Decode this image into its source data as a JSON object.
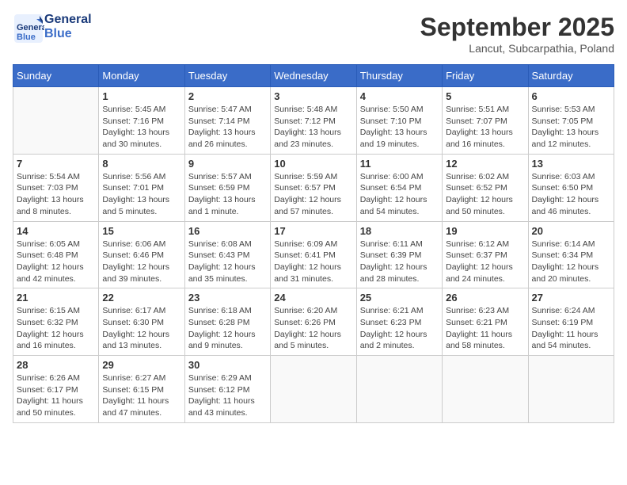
{
  "header": {
    "logo_text_general": "General",
    "logo_text_blue": "Blue",
    "month_title": "September 2025",
    "location": "Lancut, Subcarpathia, Poland"
  },
  "weekdays": [
    "Sunday",
    "Monday",
    "Tuesday",
    "Wednesday",
    "Thursday",
    "Friday",
    "Saturday"
  ],
  "weeks": [
    [
      {
        "day": "",
        "sunrise": "",
        "sunset": "",
        "daylight": ""
      },
      {
        "day": "1",
        "sunrise": "Sunrise: 5:45 AM",
        "sunset": "Sunset: 7:16 PM",
        "daylight": "Daylight: 13 hours and 30 minutes."
      },
      {
        "day": "2",
        "sunrise": "Sunrise: 5:47 AM",
        "sunset": "Sunset: 7:14 PM",
        "daylight": "Daylight: 13 hours and 26 minutes."
      },
      {
        "day": "3",
        "sunrise": "Sunrise: 5:48 AM",
        "sunset": "Sunset: 7:12 PM",
        "daylight": "Daylight: 13 hours and 23 minutes."
      },
      {
        "day": "4",
        "sunrise": "Sunrise: 5:50 AM",
        "sunset": "Sunset: 7:10 PM",
        "daylight": "Daylight: 13 hours and 19 minutes."
      },
      {
        "day": "5",
        "sunrise": "Sunrise: 5:51 AM",
        "sunset": "Sunset: 7:07 PM",
        "daylight": "Daylight: 13 hours and 16 minutes."
      },
      {
        "day": "6",
        "sunrise": "Sunrise: 5:53 AM",
        "sunset": "Sunset: 7:05 PM",
        "daylight": "Daylight: 13 hours and 12 minutes."
      }
    ],
    [
      {
        "day": "7",
        "sunrise": "Sunrise: 5:54 AM",
        "sunset": "Sunset: 7:03 PM",
        "daylight": "Daylight: 13 hours and 8 minutes."
      },
      {
        "day": "8",
        "sunrise": "Sunrise: 5:56 AM",
        "sunset": "Sunset: 7:01 PM",
        "daylight": "Daylight: 13 hours and 5 minutes."
      },
      {
        "day": "9",
        "sunrise": "Sunrise: 5:57 AM",
        "sunset": "Sunset: 6:59 PM",
        "daylight": "Daylight: 13 hours and 1 minute."
      },
      {
        "day": "10",
        "sunrise": "Sunrise: 5:59 AM",
        "sunset": "Sunset: 6:57 PM",
        "daylight": "Daylight: 12 hours and 57 minutes."
      },
      {
        "day": "11",
        "sunrise": "Sunrise: 6:00 AM",
        "sunset": "Sunset: 6:54 PM",
        "daylight": "Daylight: 12 hours and 54 minutes."
      },
      {
        "day": "12",
        "sunrise": "Sunrise: 6:02 AM",
        "sunset": "Sunset: 6:52 PM",
        "daylight": "Daylight: 12 hours and 50 minutes."
      },
      {
        "day": "13",
        "sunrise": "Sunrise: 6:03 AM",
        "sunset": "Sunset: 6:50 PM",
        "daylight": "Daylight: 12 hours and 46 minutes."
      }
    ],
    [
      {
        "day": "14",
        "sunrise": "Sunrise: 6:05 AM",
        "sunset": "Sunset: 6:48 PM",
        "daylight": "Daylight: 12 hours and 42 minutes."
      },
      {
        "day": "15",
        "sunrise": "Sunrise: 6:06 AM",
        "sunset": "Sunset: 6:46 PM",
        "daylight": "Daylight: 12 hours and 39 minutes."
      },
      {
        "day": "16",
        "sunrise": "Sunrise: 6:08 AM",
        "sunset": "Sunset: 6:43 PM",
        "daylight": "Daylight: 12 hours and 35 minutes."
      },
      {
        "day": "17",
        "sunrise": "Sunrise: 6:09 AM",
        "sunset": "Sunset: 6:41 PM",
        "daylight": "Daylight: 12 hours and 31 minutes."
      },
      {
        "day": "18",
        "sunrise": "Sunrise: 6:11 AM",
        "sunset": "Sunset: 6:39 PM",
        "daylight": "Daylight: 12 hours and 28 minutes."
      },
      {
        "day": "19",
        "sunrise": "Sunrise: 6:12 AM",
        "sunset": "Sunset: 6:37 PM",
        "daylight": "Daylight: 12 hours and 24 minutes."
      },
      {
        "day": "20",
        "sunrise": "Sunrise: 6:14 AM",
        "sunset": "Sunset: 6:34 PM",
        "daylight": "Daylight: 12 hours and 20 minutes."
      }
    ],
    [
      {
        "day": "21",
        "sunrise": "Sunrise: 6:15 AM",
        "sunset": "Sunset: 6:32 PM",
        "daylight": "Daylight: 12 hours and 16 minutes."
      },
      {
        "day": "22",
        "sunrise": "Sunrise: 6:17 AM",
        "sunset": "Sunset: 6:30 PM",
        "daylight": "Daylight: 12 hours and 13 minutes."
      },
      {
        "day": "23",
        "sunrise": "Sunrise: 6:18 AM",
        "sunset": "Sunset: 6:28 PM",
        "daylight": "Daylight: 12 hours and 9 minutes."
      },
      {
        "day": "24",
        "sunrise": "Sunrise: 6:20 AM",
        "sunset": "Sunset: 6:26 PM",
        "daylight": "Daylight: 12 hours and 5 minutes."
      },
      {
        "day": "25",
        "sunrise": "Sunrise: 6:21 AM",
        "sunset": "Sunset: 6:23 PM",
        "daylight": "Daylight: 12 hours and 2 minutes."
      },
      {
        "day": "26",
        "sunrise": "Sunrise: 6:23 AM",
        "sunset": "Sunset: 6:21 PM",
        "daylight": "Daylight: 11 hours and 58 minutes."
      },
      {
        "day": "27",
        "sunrise": "Sunrise: 6:24 AM",
        "sunset": "Sunset: 6:19 PM",
        "daylight": "Daylight: 11 hours and 54 minutes."
      }
    ],
    [
      {
        "day": "28",
        "sunrise": "Sunrise: 6:26 AM",
        "sunset": "Sunset: 6:17 PM",
        "daylight": "Daylight: 11 hours and 50 minutes."
      },
      {
        "day": "29",
        "sunrise": "Sunrise: 6:27 AM",
        "sunset": "Sunset: 6:15 PM",
        "daylight": "Daylight: 11 hours and 47 minutes."
      },
      {
        "day": "30",
        "sunrise": "Sunrise: 6:29 AM",
        "sunset": "Sunset: 6:12 PM",
        "daylight": "Daylight: 11 hours and 43 minutes."
      },
      {
        "day": "",
        "sunrise": "",
        "sunset": "",
        "daylight": ""
      },
      {
        "day": "",
        "sunrise": "",
        "sunset": "",
        "daylight": ""
      },
      {
        "day": "",
        "sunrise": "",
        "sunset": "",
        "daylight": ""
      },
      {
        "day": "",
        "sunrise": "",
        "sunset": "",
        "daylight": ""
      }
    ]
  ]
}
